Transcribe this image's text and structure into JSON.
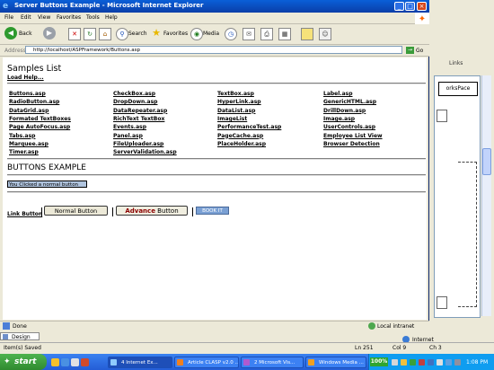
{
  "window": {
    "title": "Server Buttons Example - Microsoft Internet Explorer",
    "minimize": "_",
    "maximize": "□",
    "close": "×"
  },
  "menu": [
    "File",
    "Edit",
    "View",
    "Favorites",
    "Tools",
    "Help"
  ],
  "toolbar": {
    "back": "Back",
    "search": "Search",
    "favorites": "Favorites",
    "media": "Media"
  },
  "address": {
    "label": "Address",
    "url": "http://localhost/ASPFramework/Buttons.asp",
    "go": "Go"
  },
  "page": {
    "samples_title": "Samples List",
    "load_help": "Load Help...",
    "links": [
      [
        "Buttons.asp",
        "CheckBox.asp",
        "TextBox.asp",
        "Label.asp"
      ],
      [
        "RadioButton.asp",
        "DropDown.asp",
        "HyperLink.asp",
        "GenericHTML.asp"
      ],
      [
        "DataGrid.asp",
        "DataRepeater.asp",
        "DataList.asp",
        "DrillDown.asp"
      ],
      [
        "Formated TextBoxes",
        "RichText TextBox",
        "ImageList",
        "Image.asp"
      ],
      [
        "Page AutoFocus.asp",
        "Events.asp",
        "PerformanceTest.asp",
        "UserControls.asp"
      ],
      [
        "Tabs.asp",
        "Panel.asp",
        "PageCache.asp",
        "Employee List View"
      ],
      [
        "Marquee.asp",
        "FileUploader.asp",
        "PlaceHolder.asp",
        "Browser Detection"
      ],
      [
        "Timer.asp",
        "ServerValidation.asp",
        "",
        ""
      ]
    ],
    "buttons_title": "BUTTONS EXAMPLE",
    "status_message": "You Clicked a normal button",
    "link_button": "Link Button",
    "normal_button": "Normal Button",
    "advance_button_strong": "Advance",
    "advance_button_rest": " Button",
    "book_button": "BOOK IT"
  },
  "ie_status": {
    "done": "Done",
    "zone": "Local intranet"
  },
  "background_app": {
    "links_label": "Links",
    "frame_tab": "orksPace",
    "design_tab": "Design",
    "status_left": "Item(s) Saved",
    "ln": "Ln 251",
    "col": "Col 9",
    "ch": "Ch 3",
    "internet": "Internet"
  },
  "taskbar": {
    "start": "start",
    "tasks": [
      "4 Internet Ex...",
      "Article CLASP v2.0 ...",
      "2 Microsoft Vis...",
      "Windows Media ..."
    ],
    "tray_percent": "100%",
    "clock": "1:08 PM"
  },
  "colors": {
    "titlebar": "#0a4fc0",
    "taskbar": "#245dd6",
    "start": "#2f8a2f",
    "status_label_bg": "#b0c4de",
    "book_button_bg": "#7aa0d4",
    "advance_text": "#8b0000"
  },
  "icons": [
    "ie-logo-icon",
    "back-icon",
    "forward-icon",
    "stop-icon",
    "refresh-icon",
    "home-icon",
    "search-icon",
    "favorites-icon",
    "media-icon",
    "history-icon",
    "mail-icon",
    "print-icon",
    "edit-icon",
    "go-icon",
    "windows-logo-icon"
  ]
}
